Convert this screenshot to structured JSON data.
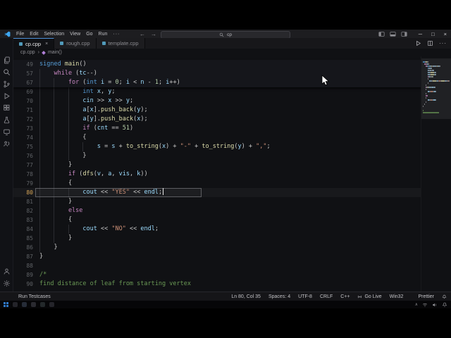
{
  "title_bar": {
    "logo_icon": "vscode-logo-icon",
    "menus": [
      "File",
      "Edit",
      "Selection",
      "View",
      "Go",
      "Run"
    ],
    "menus_overflow": "···",
    "nav": {
      "back": "←",
      "forward": "→"
    },
    "command_center": {
      "icon": "search-icon",
      "query": "cp"
    },
    "layout_icons": [
      "toggle-sidebar-icon",
      "toggle-panel-icon",
      "toggle-secondary-sidebar-icon"
    ],
    "window_controls": [
      {
        "name": "minimize-icon",
        "glyph": "─"
      },
      {
        "name": "maximize-icon",
        "glyph": "□"
      },
      {
        "name": "close-icon",
        "glyph": "×"
      }
    ]
  },
  "tab_bar": {
    "tabs": [
      {
        "label": "cp.cpp",
        "active": true
      },
      {
        "label": "rough.cpp",
        "active": false
      },
      {
        "label": "template.cpp",
        "active": false
      }
    ],
    "close_glyph": "×",
    "actions": [
      "run-file-icon",
      "split-editor-icon",
      "more-actions-icon"
    ],
    "more_glyph": "···"
  },
  "breadcrumb": {
    "file": "cp.cpp",
    "separator": "›",
    "symbol": "main()"
  },
  "activity_bar": {
    "top": [
      "explorer-icon",
      "search-icon",
      "source-control-icon",
      "run-debug-icon",
      "extensions-icon",
      "testing-icon",
      "remote-icon",
      "liveshare-icon"
    ],
    "bottom": [
      "account-icon",
      "settings-gear-icon"
    ]
  },
  "editor": {
    "active_line": 80,
    "cursor": {
      "line": 80,
      "col": 35
    },
    "lines": [
      {
        "n": 49,
        "i": 0,
        "sticky": true,
        "t": [
          [
            "k",
            "signed"
          ],
          [
            "p",
            " "
          ],
          [
            "f",
            "main"
          ],
          [
            "p",
            "()"
          ]
        ]
      },
      {
        "n": 57,
        "i": 4,
        "sticky": true,
        "t": [
          [
            "c",
            "while"
          ],
          [
            "p",
            " ("
          ],
          [
            "v",
            "tc"
          ],
          [
            "p",
            "--)"
          ]
        ]
      },
      {
        "n": 67,
        "i": 8,
        "sticky": true,
        "t": [
          [
            "c",
            "for"
          ],
          [
            "p",
            " ("
          ],
          [
            "k",
            "int"
          ],
          [
            "p",
            " "
          ],
          [
            "v",
            "i"
          ],
          [
            "p",
            " = "
          ],
          [
            "n",
            "0"
          ],
          [
            "p",
            "; "
          ],
          [
            "v",
            "i"
          ],
          [
            "p",
            " < "
          ],
          [
            "v",
            "n"
          ],
          [
            "p",
            " - "
          ],
          [
            "n",
            "1"
          ],
          [
            "p",
            "; "
          ],
          [
            "v",
            "i"
          ],
          [
            "p",
            "++)"
          ]
        ]
      },
      {
        "n": 69,
        "i": 12,
        "t": [
          [
            "k",
            "int"
          ],
          [
            "p",
            " "
          ],
          [
            "v",
            "x"
          ],
          [
            "p",
            ", "
          ],
          [
            "v",
            "y"
          ],
          [
            "p",
            ";"
          ]
        ]
      },
      {
        "n": 70,
        "i": 12,
        "t": [
          [
            "v",
            "cin"
          ],
          [
            "p",
            " >> "
          ],
          [
            "v",
            "x"
          ],
          [
            "p",
            " >> "
          ],
          [
            "v",
            "y"
          ],
          [
            "p",
            ";"
          ]
        ]
      },
      {
        "n": 71,
        "i": 12,
        "t": [
          [
            "v",
            "a"
          ],
          [
            "p",
            "["
          ],
          [
            "v",
            "x"
          ],
          [
            "p",
            "]."
          ],
          [
            "f",
            "push_back"
          ],
          [
            "p",
            "("
          ],
          [
            "v",
            "y"
          ],
          [
            "p",
            ");"
          ]
        ]
      },
      {
        "n": 72,
        "i": 12,
        "t": [
          [
            "v",
            "a"
          ],
          [
            "p",
            "["
          ],
          [
            "v",
            "y"
          ],
          [
            "p",
            "]."
          ],
          [
            "f",
            "push_back"
          ],
          [
            "p",
            "("
          ],
          [
            "v",
            "x"
          ],
          [
            "p",
            ");"
          ]
        ]
      },
      {
        "n": 73,
        "i": 12,
        "t": [
          [
            "c",
            "if"
          ],
          [
            "p",
            " ("
          ],
          [
            "v",
            "cnt"
          ],
          [
            "p",
            " == "
          ],
          [
            "n",
            "51"
          ],
          [
            "p",
            ")"
          ]
        ]
      },
      {
        "n": 74,
        "i": 12,
        "t": [
          [
            "p",
            "{"
          ]
        ]
      },
      {
        "n": 75,
        "i": 16,
        "t": [
          [
            "v",
            "s"
          ],
          [
            "p",
            " = "
          ],
          [
            "v",
            "s"
          ],
          [
            "p",
            " + "
          ],
          [
            "f",
            "to_string"
          ],
          [
            "p",
            "("
          ],
          [
            "v",
            "x"
          ],
          [
            "p",
            ") + "
          ],
          [
            "s",
            "\"-\""
          ],
          [
            "p",
            " + "
          ],
          [
            "f",
            "to_string"
          ],
          [
            "p",
            "("
          ],
          [
            "v",
            "y"
          ],
          [
            "p",
            ") + "
          ],
          [
            "s",
            "\",\""
          ],
          [
            "p",
            ";"
          ]
        ]
      },
      {
        "n": 76,
        "i": 12,
        "t": [
          [
            "p",
            "}"
          ]
        ]
      },
      {
        "n": 77,
        "i": 8,
        "t": [
          [
            "p",
            "}"
          ]
        ]
      },
      {
        "n": 78,
        "i": 8,
        "t": [
          [
            "c",
            "if"
          ],
          [
            "p",
            " ("
          ],
          [
            "f",
            "dfs"
          ],
          [
            "p",
            "("
          ],
          [
            "v",
            "v"
          ],
          [
            "p",
            ", "
          ],
          [
            "v",
            "a"
          ],
          [
            "p",
            ", "
          ],
          [
            "v",
            "vis"
          ],
          [
            "p",
            ", "
          ],
          [
            "v",
            "k"
          ],
          [
            "p",
            "))"
          ]
        ]
      },
      {
        "n": 79,
        "i": 8,
        "t": [
          [
            "p",
            "{"
          ]
        ]
      },
      {
        "n": 80,
        "i": 12,
        "t": [
          [
            "v",
            "cout"
          ],
          [
            "p",
            " << "
          ],
          [
            "s",
            "\"YES\""
          ],
          [
            "p",
            " << "
          ],
          [
            "v",
            "endl"
          ],
          [
            "p",
            ";"
          ]
        ]
      },
      {
        "n": 81,
        "i": 8,
        "t": [
          [
            "p",
            "}"
          ]
        ]
      },
      {
        "n": 82,
        "i": 8,
        "t": [
          [
            "c",
            "else"
          ]
        ]
      },
      {
        "n": 83,
        "i": 8,
        "t": [
          [
            "p",
            "{"
          ]
        ]
      },
      {
        "n": 84,
        "i": 12,
        "t": [
          [
            "v",
            "cout"
          ],
          [
            "p",
            " << "
          ],
          [
            "s",
            "\"NO\""
          ],
          [
            "p",
            " << "
          ],
          [
            "v",
            "endl"
          ],
          [
            "p",
            ";"
          ]
        ]
      },
      {
        "n": 85,
        "i": 8,
        "t": [
          [
            "p",
            "}"
          ]
        ]
      },
      {
        "n": 86,
        "i": 4,
        "t": [
          [
            "p",
            "}"
          ]
        ]
      },
      {
        "n": 87,
        "i": 0,
        "t": [
          [
            "p",
            "}"
          ]
        ]
      },
      {
        "n": 88,
        "i": 0,
        "t": []
      },
      {
        "n": 89,
        "i": 0,
        "t": [
          [
            "m",
            "/*"
          ]
        ]
      },
      {
        "n": 90,
        "i": 0,
        "t": [
          [
            "m",
            "find distance of leaf from starting vertex"
          ]
        ]
      }
    ]
  },
  "status_bar": {
    "left": [
      {
        "label": "Run Testcases"
      }
    ],
    "right": [
      {
        "label": "Ln 80, Col 35"
      },
      {
        "label": "Spaces: 4"
      },
      {
        "label": "UTF-8"
      },
      {
        "label": "CRLF"
      },
      {
        "label": "C++"
      },
      {
        "label": "Go Live",
        "icon": "broadcast-icon"
      },
      {
        "label": "Win32"
      },
      {
        "label": "Prettier",
        "icon": "check-icon"
      },
      {
        "icon": "notification-bell-icon"
      }
    ]
  },
  "taskbar": {
    "start": "windows-start-icon",
    "apps": [
      "taskbar-app-icon",
      "taskbar-app-icon",
      "taskbar-app-icon",
      "taskbar-app-icon",
      "taskbar-app-icon"
    ],
    "tray": [
      "tray-chevron-icon",
      "tray-network-icon",
      "tray-volume-icon"
    ]
  },
  "colors": {
    "accent_tab": "#4c8fd6",
    "keyword": "#569cd6",
    "control": "#c586c0",
    "function": "#dcdcaa",
    "variable": "#9cdcfe",
    "number": "#b5cea8",
    "string": "#ce9178",
    "comment": "#6a9955",
    "punctuation": "#c8c8c8",
    "active_line_number": "#d8a657"
  }
}
